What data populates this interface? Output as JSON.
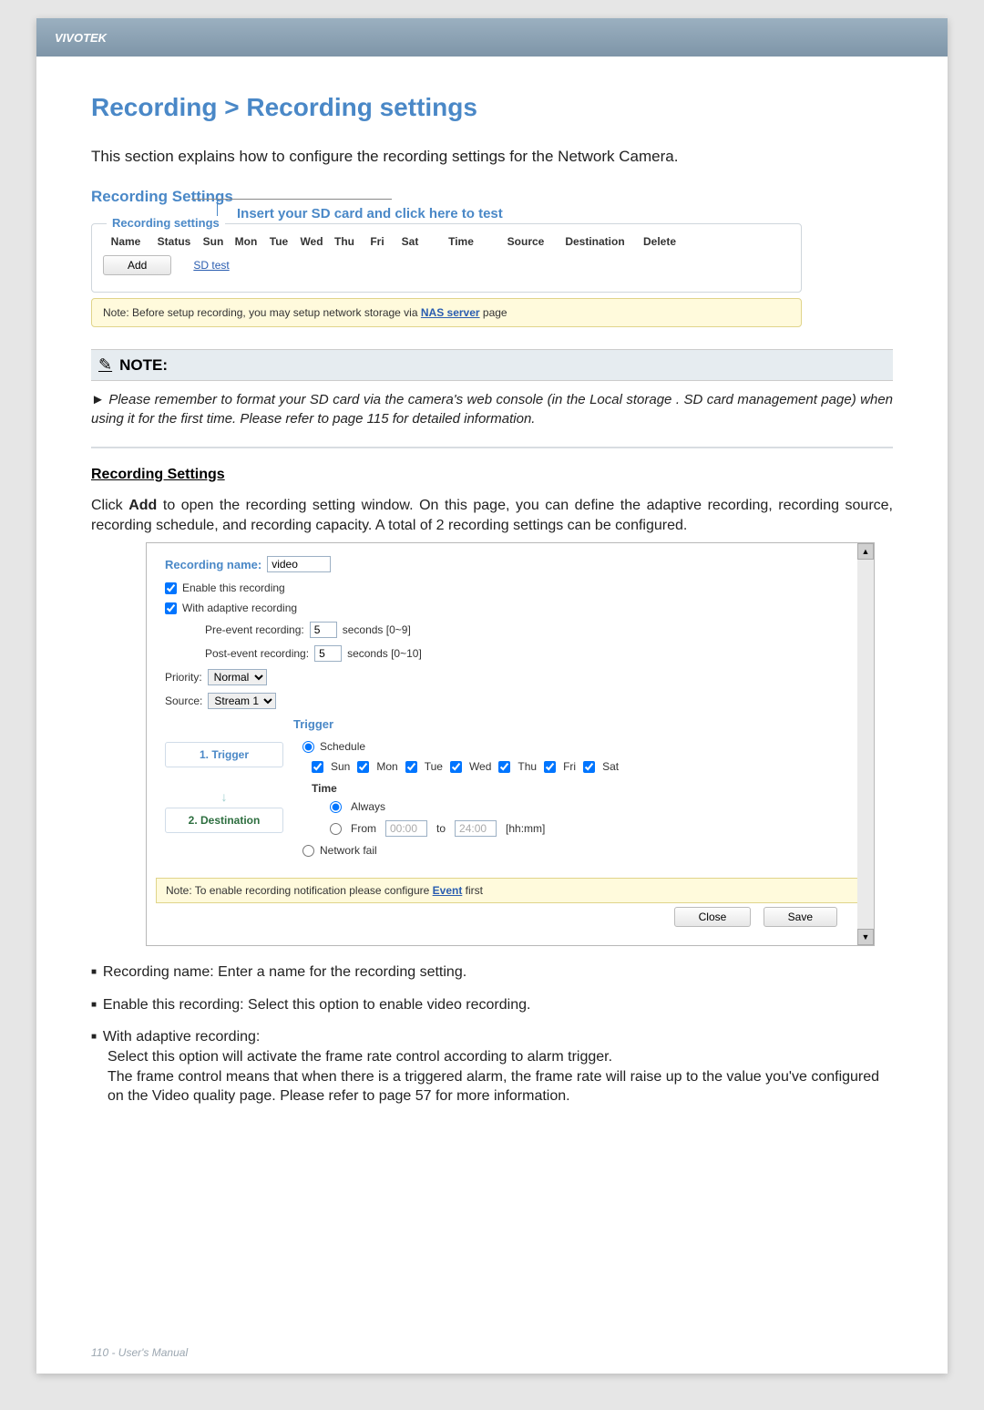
{
  "brand": "VIVOTEK",
  "page_title": "Recording > Recording settings",
  "intro": "This section explains how to configure the recording settings for the Network Camera.",
  "rs_head": "Recording Settings",
  "insert_callout": "Insert your SD card and click here to test",
  "settings_box": {
    "legend": "Recording settings",
    "columns": [
      "Name",
      "Status",
      "Sun",
      "Mon",
      "Tue",
      "Wed",
      "Thu",
      "Fri",
      "Sat",
      "Time",
      "Source",
      "Destination",
      "Delete"
    ],
    "add_label": "Add",
    "sd_test": "SD test"
  },
  "note_strip_prefix": "Note: Before setup recording, you may setup network storage via ",
  "note_strip_link": "NAS server",
  "note_strip_suffix": " page",
  "note_header": "NOTE:",
  "note_body": "Please remember to format your SD card via the camera's web console (in the Local storage . SD card management page) when using it for the first time. Please refer to page 115 for detailed information.",
  "rs_underline": "Recording Settings",
  "add_para_prefix": "Click ",
  "add_para_bold": "Add",
  "add_para_suffix": " to open the recording setting window. On this page, you can define the adaptive recording, recording source, recording schedule, and recording capacity. A total of 2 recording settings can be configured.",
  "panel": {
    "rec_name_label": "Recording name:",
    "rec_name_value": "video",
    "enable_label": "Enable this recording",
    "adaptive_label": "With adaptive recording",
    "pre_label": "Pre-event recording:",
    "pre_value": "5",
    "pre_suffix": "seconds [0~9]",
    "post_label": "Post-event recording:",
    "post_value": "5",
    "post_suffix": "seconds [0~10]",
    "priority_label": "Priority:",
    "priority_value": "Normal",
    "source_label": "Source:",
    "source_value": "Stream 1",
    "step1": "1. Trigger",
    "step2": "2. Destination",
    "trigger_title": "Trigger",
    "schedule_label": "Schedule",
    "days": [
      "Sun",
      "Mon",
      "Tue",
      "Wed",
      "Thu",
      "Fri",
      "Sat"
    ],
    "time_head": "Time",
    "always_label": "Always",
    "from_label": "From",
    "from_value": "00:00",
    "to_label": "to",
    "to_value": "24:00",
    "hhmm": "[hh:mm]",
    "network_fail": "Network fail",
    "panel_note_prefix": "Note: To enable recording notification please configure ",
    "panel_note_link": "Event",
    "panel_note_suffix": " first",
    "close": "Close",
    "save": "Save"
  },
  "bullets": {
    "b1": "Recording name: Enter a name for the recording setting.",
    "b2": "Enable this recording: Select this option to enable video recording.",
    "b3_head": "With adaptive recording:",
    "b3_line1": "Select this option will activate the frame rate control according to alarm trigger.",
    "b3_line2": "The frame control means that when there is a triggered alarm, the frame rate will raise up to the value you've configured on the Video quality page. Please refer to page 57 for more information."
  },
  "footer": "110 - User's Manual",
  "arrow_marker": "►"
}
